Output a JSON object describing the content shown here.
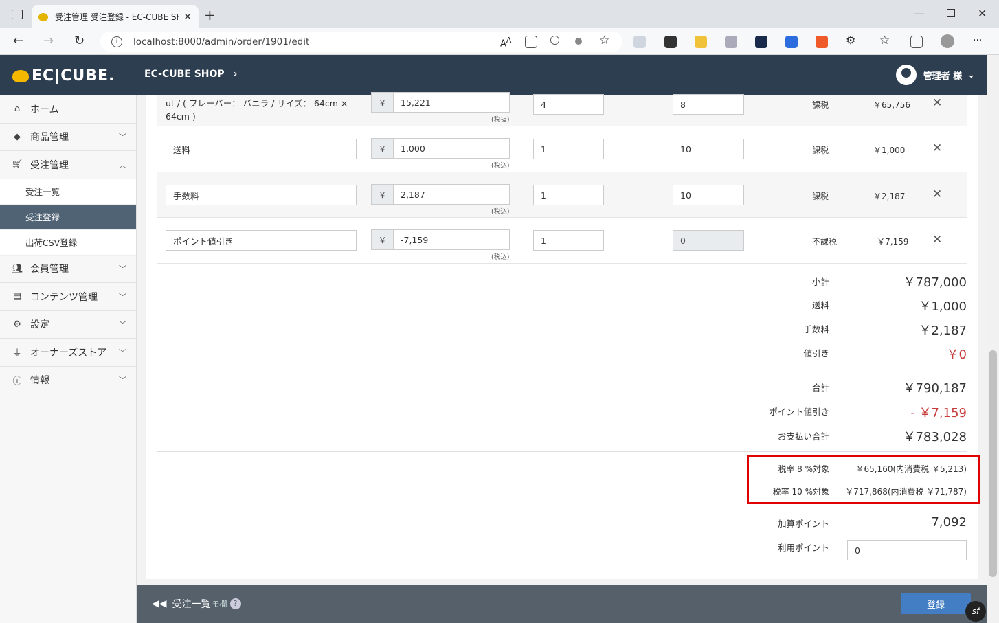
{
  "browser": {
    "tab_title": "受注管理 受注登録 - EC-CUBE SH",
    "url": "localhost:8000/admin/order/1901/edit"
  },
  "header": {
    "logo": "EC|CUBE.",
    "shop_name": "EC-CUBE SHOP",
    "user": "管理者 様"
  },
  "sidebar": {
    "items": [
      {
        "label": "ホーム",
        "icon": "home-icon"
      },
      {
        "label": "商品管理",
        "icon": "cube-icon"
      },
      {
        "label": "受注管理",
        "icon": "cart-icon"
      },
      {
        "label": "会員管理",
        "icon": "users-icon"
      },
      {
        "label": "コンテンツ管理",
        "icon": "file-icon"
      },
      {
        "label": "設定",
        "icon": "gear-icon"
      },
      {
        "label": "オーナーズストア",
        "icon": "plug-icon"
      },
      {
        "label": "情報",
        "icon": "info-icon"
      }
    ],
    "sub_items": [
      "受注一覧",
      "受注登録",
      "出荷CSV登録"
    ]
  },
  "rows": [
    {
      "name": "ut / ( フレーバー： バニラ / サイズ： 64cm × 64cm )",
      "price": "15,221",
      "note": "(税抜)",
      "qty": "4",
      "rate": "8",
      "tax": "課税",
      "amount": "￥65,756"
    },
    {
      "name": "送料",
      "price": "1,000",
      "note": "(税込)",
      "qty": "1",
      "rate": "10",
      "tax": "課税",
      "amount": "￥1,000"
    },
    {
      "name": "手数料",
      "price": "2,187",
      "note": "(税込)",
      "qty": "1",
      "rate": "10",
      "tax": "課税",
      "amount": "￥2,187"
    },
    {
      "name": "ポイント値引き",
      "price": "-7,159",
      "note": "(税込)",
      "qty": "1",
      "rate": "0",
      "tax": "不課税",
      "amount": "- ￥7,159"
    }
  ],
  "yen": "￥",
  "summary": {
    "subtotal_label": "小計",
    "subtotal": "￥787,000",
    "shipping_label": "送料",
    "shipping": "￥1,000",
    "fee_label": "手数料",
    "fee": "￥2,187",
    "discount_label": "値引き",
    "discount": "￥0",
    "total_label": "合計",
    "total": "￥790,187",
    "point_discount_label": "ポイント値引き",
    "point_discount": "- ￥7,159",
    "payment_label": "お支払い合計",
    "payment": "￥783,028",
    "tax8_label": "税率 8 %対象",
    "tax8": "￥65,160(内消費税 ￥5,213)",
    "tax10_label": "税率 10 %対象",
    "tax10": "￥717,868(内消費税 ￥71,787)",
    "add_point_label": "加算ポイント",
    "add_point": "7,092",
    "use_point_label": "利用ポイント",
    "use_point": "0"
  },
  "footer": {
    "back_label": "受注一覧",
    "back_extra": "モ欄",
    "submit_label": "登録"
  }
}
